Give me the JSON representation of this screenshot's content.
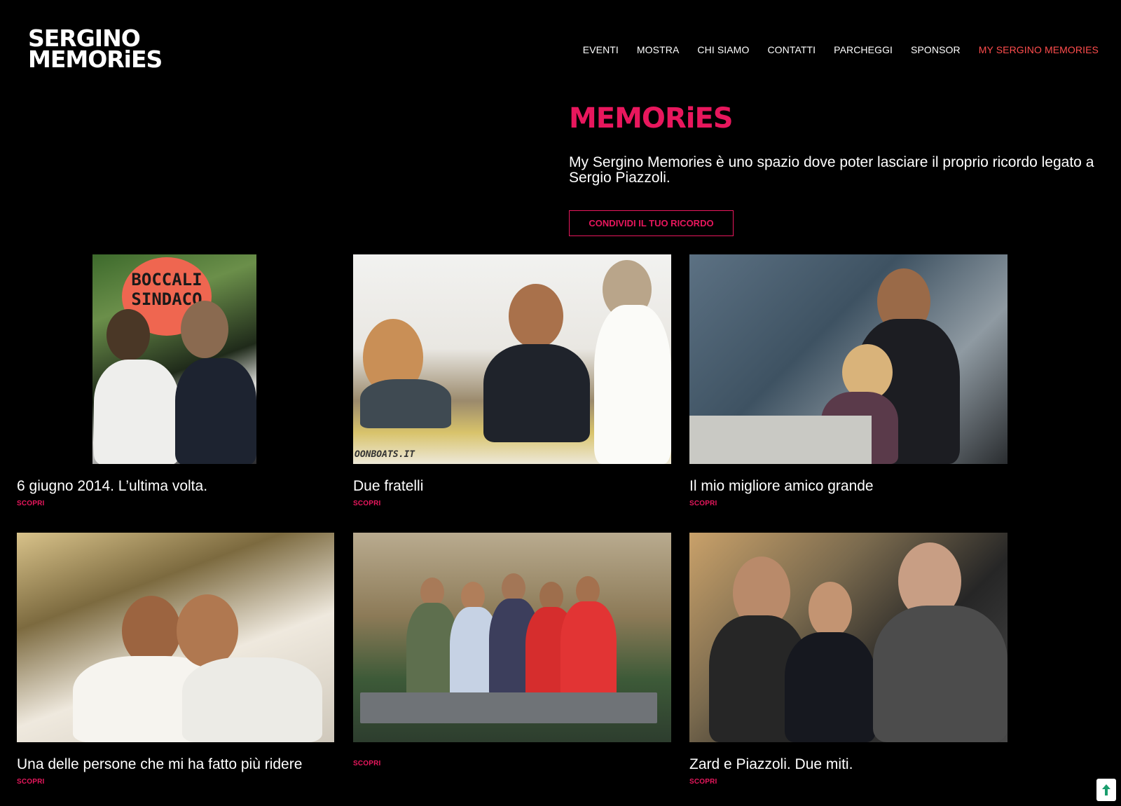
{
  "logo": {
    "line1": "SERGINO",
    "line2": "MEMORiES"
  },
  "nav": {
    "items": [
      "EVENTI",
      "MOSTRA",
      "CHI SIAMO",
      "CONTATTI",
      "PARCHEGGI",
      "SPONSOR",
      "MY SERGINO MEMORIES"
    ],
    "active_index": 6
  },
  "hero": {
    "title": "MEMORiES",
    "text": "My Sergino Memories è uno spazio dove poter lasciare il proprio ricordo legato a Sergio Piazzoli.",
    "cta": "CONDIVIDI IL TUO RICORDO"
  },
  "photo_texts": {
    "sign": "BOCCALI SINDACO",
    "boat": "OONBOATS.IT"
  },
  "cards": [
    {
      "title": "6 giugno 2014. L’ultima volta.",
      "link": "SCOPRI"
    },
    {
      "title": "Due fratelli",
      "link": "SCOPRI"
    },
    {
      "title": "Il mio migliore amico grande",
      "link": "SCOPRI"
    },
    {
      "title": "Una delle persone che mi ha fatto più ridere",
      "link": "SCOPRI"
    },
    {
      "title": "",
      "link": "SCOPRI"
    },
    {
      "title": "Zard e Piazzoli. Due miti.",
      "link": "SCOPRI"
    }
  ],
  "colors": {
    "accent": "#e8175d",
    "nav_active": "#ff4d4d",
    "background": "#000000"
  },
  "icons": {
    "back_to_top": "arrow-up-icon"
  }
}
